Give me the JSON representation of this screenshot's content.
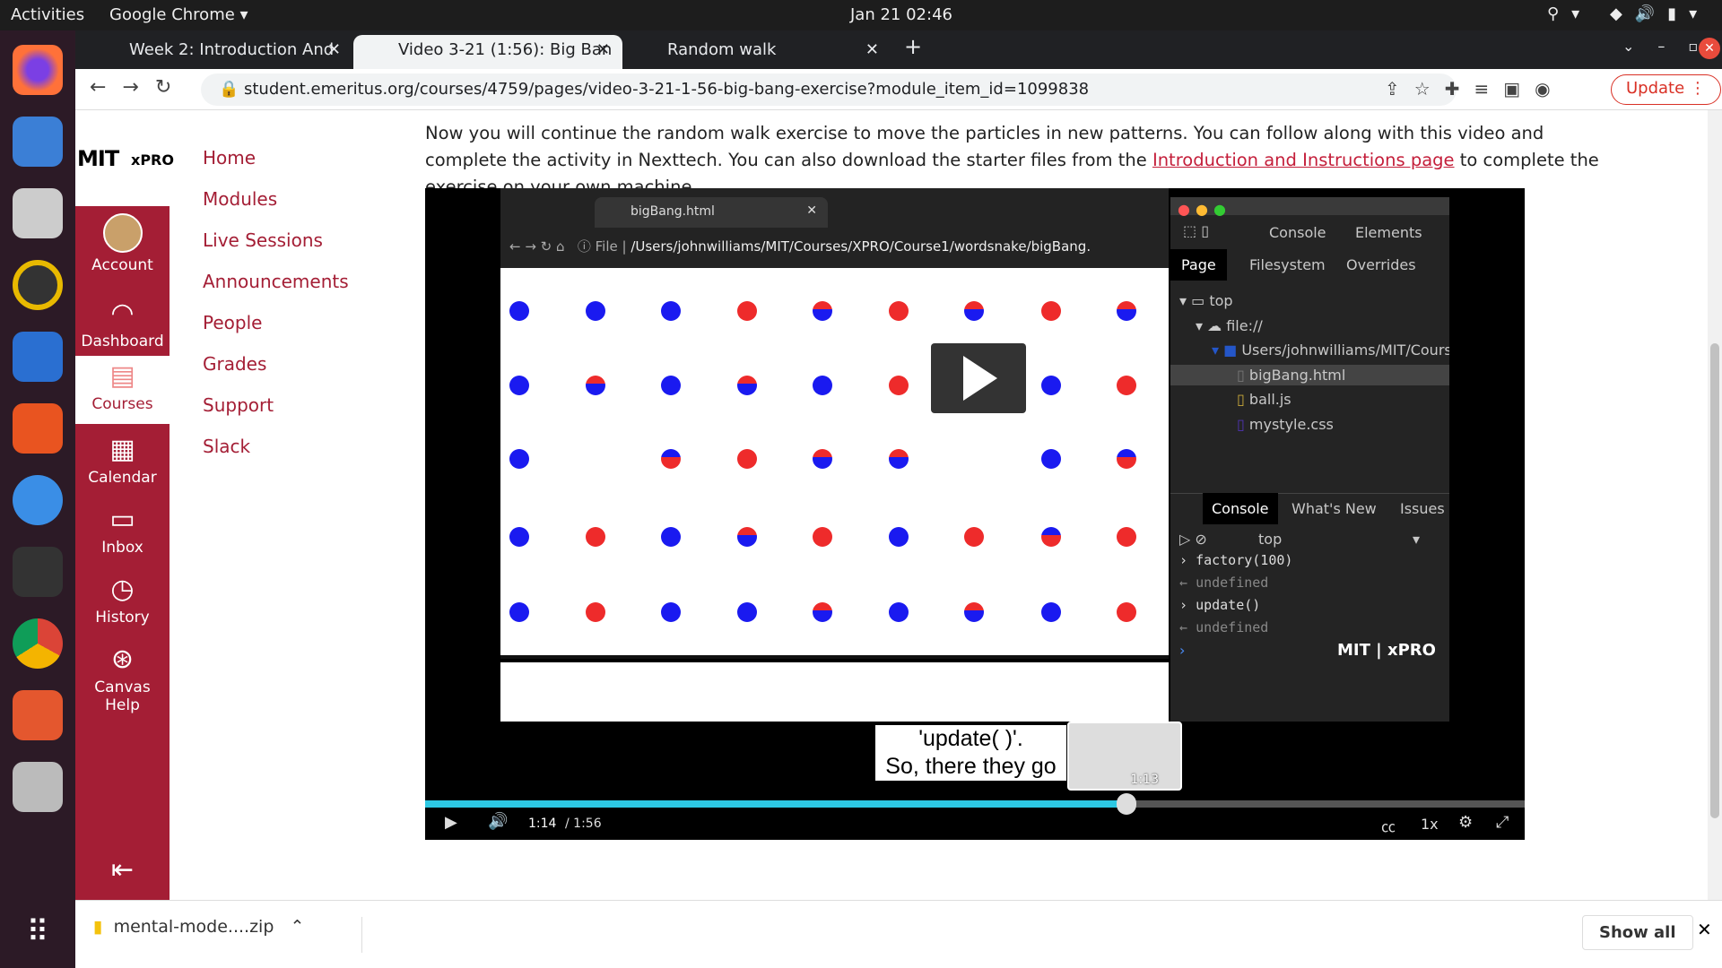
{
  "system": {
    "activities": "Activities",
    "app": "Google Chrome",
    "clock": "Jan 21  02:46"
  },
  "tabs": [
    {
      "label": "Week 2: Introduction And"
    },
    {
      "label": "Video 3-21 (1:56): Big Ban"
    },
    {
      "label": "Random walk"
    }
  ],
  "address": {
    "url": "student.emeritus.org/courses/4759/pages/video-3-21-1-56-big-bang-exercise?module_item_id=1099838",
    "update": "Update"
  },
  "logo": {
    "brand": "MIT",
    "sub": "xPRO"
  },
  "global_nav": [
    {
      "label": "Account",
      "icon": "avatar"
    },
    {
      "label": "Dashboard",
      "icon": "dashboard-icon"
    },
    {
      "label": "Courses",
      "icon": "courses-icon"
    },
    {
      "label": "Calendar",
      "icon": "calendar-icon"
    },
    {
      "label": "Inbox",
      "icon": "inbox-icon"
    },
    {
      "label": "History",
      "icon": "clock-icon"
    },
    {
      "label": "Canvas Help",
      "icon": "lifebuoy-icon"
    }
  ],
  "course_nav": [
    "Home",
    "Modules",
    "Live Sessions",
    "Announcements",
    "People",
    "Grades",
    "Support",
    "Slack"
  ],
  "content": {
    "p1": "Now you will continue the random walk exercise to move the particles in new patterns.  You can follow along with this video and complete the activity in Nexttech. You can also download the starter files from the ",
    "link": "Introduction and Instructions page",
    "p2": " to complete the exercise on your own machine."
  },
  "video": {
    "inner_tab": "bigBang.html",
    "inner_file": "File",
    "inner_path": "/Users/johnwilliams/MIT/Courses/XPRO/Course1/wordsnake/bigBang.",
    "dots": [
      "b b b r rb r rb r rb",
      "b rb b rb b r b b r",
      "b - br r rb rb - b br",
      "b r b rb r b r br r",
      "b r b b rb b rb b r"
    ],
    "colors": {
      "blue": "#1a1af0",
      "red": "#ee2b2b"
    },
    "devtools": {
      "tabs": [
        "Console",
        "Elements"
      ],
      "subtabs": [
        "Page",
        "Filesystem",
        "Overrides"
      ],
      "tree": [
        "top",
        "file://",
        "Users/johnwilliams/MIT/Courses",
        "bigBang.html",
        "ball.js",
        "mystyle.css"
      ],
      "drawer_tabs": [
        "Console",
        "What's New",
        "Issues"
      ],
      "context": "top",
      "console": [
        "factory(100)",
        "undefined",
        "update()",
        "undefined"
      ]
    },
    "caption": [
      "'update( )'.",
      "So, there they go"
    ],
    "preview_time": "1:13",
    "current": "1:14",
    "duration": "/ 1:56",
    "progress": 0.638,
    "speed": "1x",
    "watermark": "xPRO"
  },
  "download": {
    "file": "mental-mode....zip",
    "show_all": "Show all"
  }
}
